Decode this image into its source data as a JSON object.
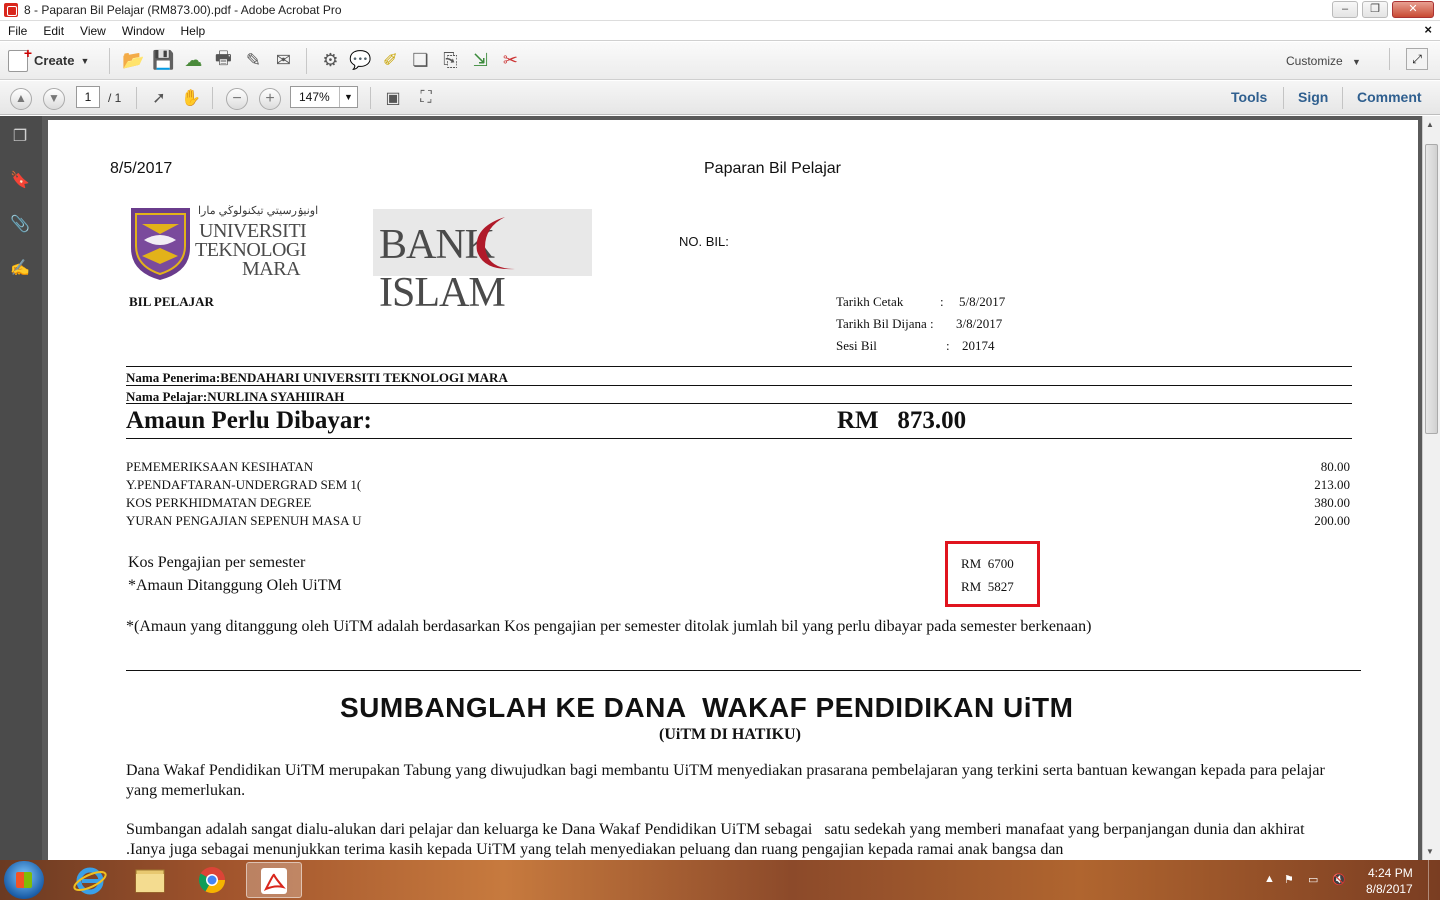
{
  "window": {
    "title": "8 - Paparan Bil Pelajar (RM873.00).pdf - Adobe Acrobat Pro"
  },
  "menu": {
    "items": [
      "File",
      "Edit",
      "View",
      "Window",
      "Help"
    ],
    "close_glyph": "×"
  },
  "toolbar": {
    "create_label": "Create",
    "customize_label": "Customize"
  },
  "nav": {
    "page_current": "1",
    "page_total": "/ 1",
    "zoom": "147%"
  },
  "panes": {
    "tools": "Tools",
    "sign": "Sign",
    "comment": "Comment"
  },
  "document": {
    "date": "8/5/2017",
    "header": "Paparan Bil Pelajar",
    "uitm_logo": {
      "jawi": "اونيۏرسيتي تيكنولوڬي مارا",
      "line1": "UNIVERSITI",
      "line2": "TEKNOLOGI",
      "line3": "MARA"
    },
    "bank_logo": {
      "text": "BANK ISLAM"
    },
    "no_bil_label": "NO. BIL:",
    "bil_pelajar": "BIL PELAJAR",
    "meta": {
      "tarikh_cetak_label": "Tarikh Cetak",
      "tarikh_cetak_sep": ":",
      "tarikh_cetak_value": "5/8/2017",
      "tarikh_dijana_label": "Tarikh Bil Dijana :",
      "tarikh_dijana_value": "3/8/2017",
      "sesi_label": "Sesi Bil",
      "sesi_sep": ":",
      "sesi_value": "20174"
    },
    "penerima": "Nama Penerima:BENDAHARI UNIVERSITI TEKNOLOGI MARA",
    "pelajar": "Nama Pelajar:NURLINA SYAHIIRAH",
    "amount_label": "Amaun Perlu Dibayar:",
    "amount_value": "RM   873.00",
    "items": [
      {
        "name": "PEMEMERIKSAAN KESIHATAN",
        "amount": "80.00"
      },
      {
        "name": "Y.PENDAFTARAN-UNDERGRAD SEM 1(",
        "amount": "213.00"
      },
      {
        "name": "KOS PERKHIDMATAN DEGREE",
        "amount": "380.00"
      },
      {
        "name": "YURAN PENGAJIAN SEPENUH MASA U",
        "amount": "200.00"
      }
    ],
    "cost_per_sem_label": "Kos Pengajian per semester",
    "cost_per_sem_value": "RM  6700",
    "covered_label": "*Amaun Ditanggung Oleh UiTM",
    "covered_value": "RM  5827",
    "note": "*(Amaun yang ditanggung oleh UiTM adalah berdasarkan Kos pengajian per semester ditolak jumlah bil yang perlu dibayar pada semester berkenaan)",
    "donate_title": "SUMBANGLAH KE DANA  WAKAF PENDIDIKAN UiTM",
    "donate_subtitle": "(UiTM DI HATIKU)",
    "para1": "Dana Wakaf Pendidikan UiTM merupakan Tabung yang diwujudkan bagi membantu UiTM menyediakan prasarana pembelajaran yang terkini serta bantuan kewangan kepada para pelajar yang memerlukan.",
    "para2": "Sumbangan adalah sangat dialu-alukan dari pelajar dan keluarga ke Dana Wakaf Pendidikan UiTM sebagai   satu sedekah yang memberi manafaat yang berpanjangan dunia dan akhirat .Ianya juga sebagai menunjukkan terima kasih kepada UiTM yang telah menyediakan peluang dan ruang pengajian kepada ramai anak bangsa dan"
  },
  "taskbar": {
    "time": "4:24 PM",
    "date": "8/8/2017"
  },
  "colors": {
    "highlight_box": "#e0141e",
    "pane_link": "#2f5f8f",
    "nav_pane": "#4b4b4b",
    "doc_bg": "#5a5a5a"
  }
}
